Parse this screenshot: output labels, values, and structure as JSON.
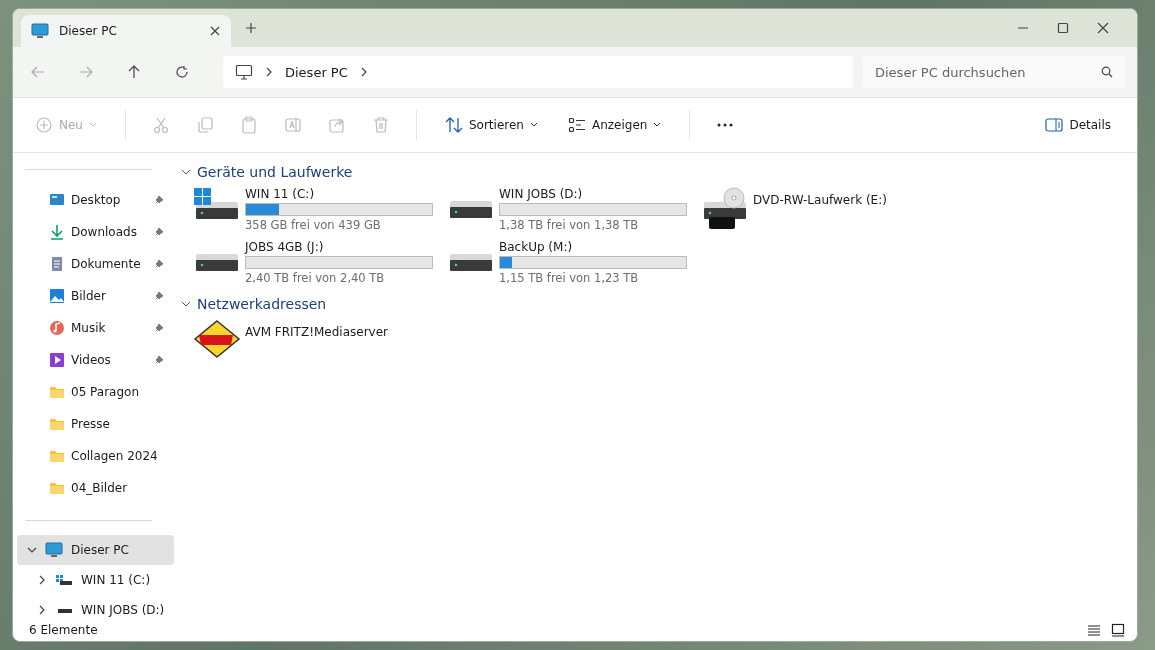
{
  "tab": {
    "title": "Dieser PC",
    "selected": true
  },
  "address": {
    "crumbs": [
      "Dieser PC"
    ]
  },
  "search": {
    "placeholder": "Dieser PC durchsuchen"
  },
  "toolbar": [
    {
      "kind": "new",
      "label": "Neu",
      "disabled": true
    },
    {
      "kind": "cut",
      "disabled": true
    },
    {
      "kind": "copy",
      "disabled": true
    },
    {
      "kind": "paste",
      "disabled": true
    },
    {
      "kind": "rename",
      "disabled": true
    },
    {
      "kind": "share",
      "disabled": true
    },
    {
      "kind": "delete",
      "disabled": true
    },
    {
      "kind": "sort",
      "label": "Sortieren",
      "disabled": false
    },
    {
      "kind": "view",
      "label": "Anzeigen",
      "disabled": false
    },
    {
      "kind": "more"
    }
  ],
  "details_button": {
    "label": "Details"
  },
  "sidebar": {
    "quick": [
      {
        "kind": "desktop",
        "label": "Desktop",
        "pinned": true
      },
      {
        "kind": "download",
        "label": "Downloads",
        "pinned": true
      },
      {
        "kind": "document",
        "label": "Dokumente",
        "pinned": true
      },
      {
        "kind": "image",
        "label": "Bilder",
        "pinned": true
      },
      {
        "kind": "music",
        "label": "Musik",
        "pinned": true
      },
      {
        "kind": "video",
        "label": "Videos",
        "pinned": true
      },
      {
        "kind": "folder",
        "label": "05 Paragon",
        "pinned": false
      },
      {
        "kind": "folder",
        "label": "Presse",
        "pinned": false
      },
      {
        "kind": "folder",
        "label": "Collagen 2024",
        "pinned": false
      },
      {
        "kind": "folder",
        "label": "04_Bilder",
        "pinned": false
      }
    ],
    "tree": [
      {
        "label": "Dieser PC",
        "kind": "pc",
        "selected": true,
        "expanded": true,
        "children": [
          {
            "label": "WIN 11 (C:)",
            "kind": "windrive",
            "selected": false,
            "expanded": false
          },
          {
            "label": "WIN JOBS (D:)",
            "kind": "drive",
            "selected": false,
            "expanded": false
          }
        ]
      }
    ]
  },
  "sections": [
    {
      "title": "Geräte und Laufwerke",
      "expanded": true,
      "items": [
        {
          "kind": "windrive",
          "name": "WIN 11 (C:)",
          "level": 0.18,
          "free": "358 GB frei von 439 GB"
        },
        {
          "kind": "drive",
          "name": "WIN JOBS (D:)",
          "level": 0,
          "free": "1,38 TB frei von 1,38 TB"
        },
        {
          "kind": "dvd",
          "name": "DVD-RW-Laufwerk (E:)"
        },
        {
          "kind": "drive",
          "name": "JOBS 4GB (J:)",
          "level": 0,
          "free": "2,40 TB frei von 2,40 TB"
        },
        {
          "kind": "drive",
          "name": "BackUp (M:)",
          "level": 0.065,
          "free": "1,15 TB frei von 1,23 TB"
        }
      ]
    },
    {
      "title": "Netzwerkadressen",
      "expanded": true,
      "items": [
        {
          "kind": "mediaserver",
          "name": "AVM FRITZ!Mediaserver"
        }
      ]
    }
  ],
  "status_bar": {
    "count": "6 Elemente"
  }
}
